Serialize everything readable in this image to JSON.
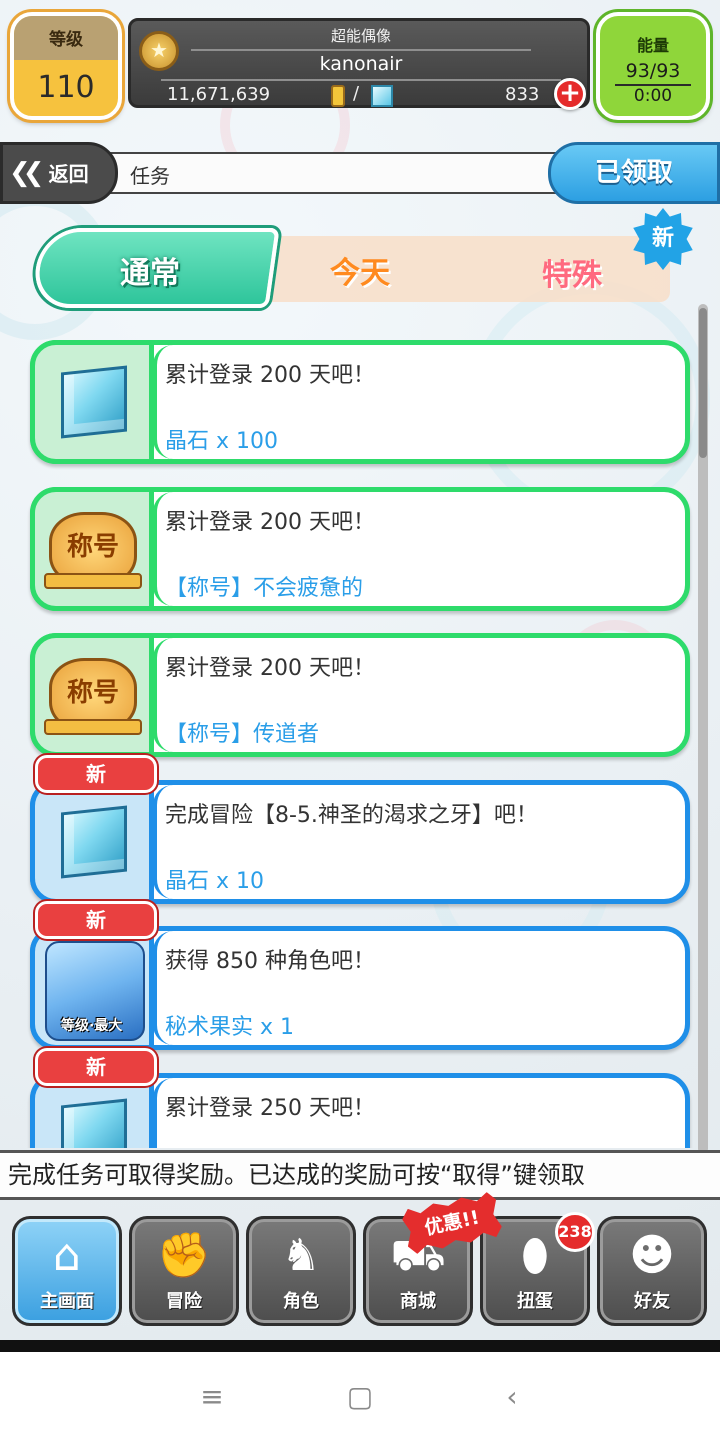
{
  "hud": {
    "level_label": "等级",
    "level_value": "110",
    "player_title": "超能偶像",
    "player_name": "kanonair",
    "gold": "11,671,639",
    "slash": "/",
    "gems": "833",
    "plus": "+",
    "energy_label": "能量",
    "energy_value": "93/93",
    "energy_timer": "0:00"
  },
  "nav": {
    "back_label": "返回",
    "page_title": "任务",
    "claimed_label": "已领取"
  },
  "tabs": [
    {
      "label": "通常",
      "active": true
    },
    {
      "label": "今天",
      "active": false
    },
    {
      "label": "特殊",
      "active": false
    }
  ],
  "new_badge": "新",
  "missions": [
    {
      "title": "累计登录 200 天吧！",
      "reward": "晶石 x 100",
      "icon": "crystal-icon",
      "style": "green",
      "is_new": false
    },
    {
      "title": "累计登录 200 天吧！",
      "reward": "【称号】不会疲惫的",
      "icon": "title-badge-icon",
      "style": "green",
      "is_new": false
    },
    {
      "title": "累计登录 200 天吧！",
      "reward": "【称号】传道者",
      "icon": "title-badge-icon",
      "style": "green",
      "is_new": false
    },
    {
      "title": "完成冒险【8-5.神圣的渴求之牙】吧！",
      "reward": "晶石 x 10",
      "icon": "crystal-icon",
      "style": "blue",
      "is_new": true
    },
    {
      "title": "获得 850 种角色吧！",
      "reward": "秘术果实 x 1",
      "icon": "character-icon",
      "style": "blue",
      "is_new": true
    },
    {
      "title": "累计登录 250 天吧！",
      "reward": "",
      "icon": "crystal-icon",
      "style": "blue",
      "is_new": true
    }
  ],
  "icon_text": {
    "title_badge": "称号",
    "char_level": "等级·最大"
  },
  "ticker": "完成任务可取得奖励。已达成的奖励可按“取得”键领取",
  "menu": [
    {
      "label": "主画面",
      "icon": "home-icon",
      "active": true
    },
    {
      "label": "冒险",
      "icon": "handshake-icon",
      "active": false
    },
    {
      "label": "角色",
      "icon": "rabbit-icon",
      "active": false
    },
    {
      "label": "商城",
      "icon": "cart-icon",
      "active": false
    },
    {
      "label": "扭蛋",
      "icon": "egg-icon",
      "active": false
    },
    {
      "label": "好友",
      "icon": "friends-icon",
      "active": false
    }
  ],
  "promo_label": "优惠!!",
  "gacha_count": "238",
  "colors": {
    "green_border": "#2edb6b",
    "blue_border": "#1f8fe8",
    "reward_text": "#2a9ee8",
    "new_red": "#e94040"
  }
}
